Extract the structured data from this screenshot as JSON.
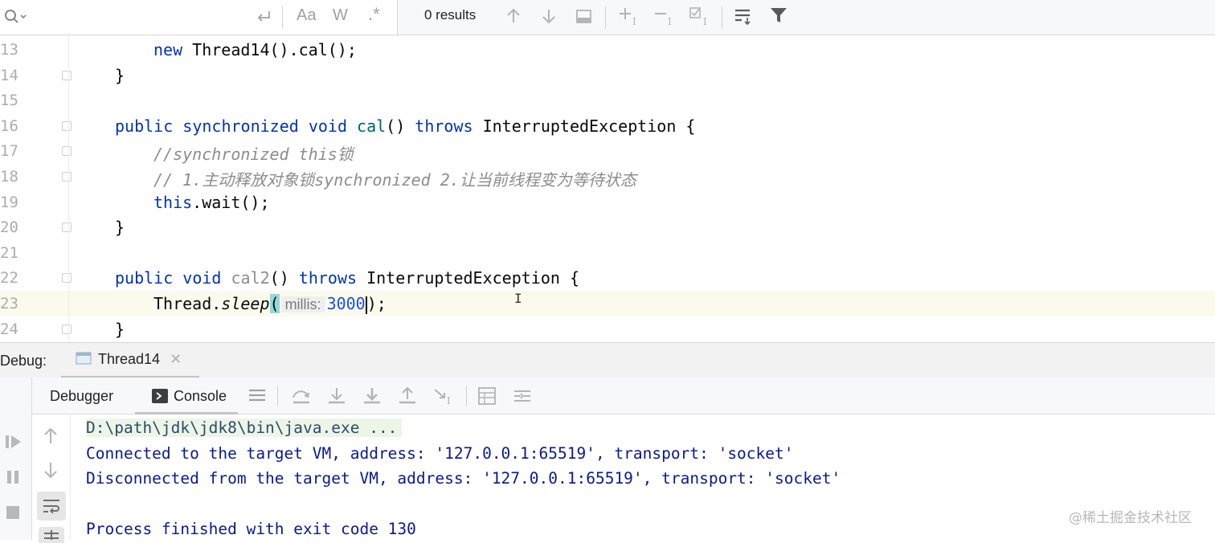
{
  "find_bar": {
    "search_value": "",
    "match_case_label": "Aa",
    "words_label": "W",
    "regex_label": ".*",
    "results": "0 results"
  },
  "editor": {
    "lines": [
      {
        "num": "13",
        "indent": 2,
        "tokens": [
          {
            "t": "new",
            "c": "kw"
          },
          {
            "t": " Thread14().cal();",
            "c": ""
          }
        ]
      },
      {
        "num": "14",
        "indent": 1,
        "tokens": [
          {
            "t": "}",
            "c": ""
          }
        ]
      },
      {
        "num": "15",
        "indent": 0,
        "tokens": []
      },
      {
        "num": "16",
        "indent": 1,
        "tokens": [
          {
            "t": "public synchronized void ",
            "c": "kw"
          },
          {
            "t": "cal",
            "c": "fn"
          },
          {
            "t": "() ",
            "c": ""
          },
          {
            "t": "throws",
            "c": "kw"
          },
          {
            "t": " InterruptedException {",
            "c": ""
          }
        ]
      },
      {
        "num": "17",
        "indent": 2,
        "tokens": [
          {
            "t": "//synchronized this锁",
            "c": "cm"
          }
        ]
      },
      {
        "num": "18",
        "indent": 2,
        "tokens": [
          {
            "t": "// 1.主动释放对象锁synchronized 2.让当前线程变为等待状态",
            "c": "cm"
          }
        ]
      },
      {
        "num": "19",
        "indent": 2,
        "tokens": [
          {
            "t": "this",
            "c": "kw"
          },
          {
            "t": ".wait();",
            "c": ""
          }
        ]
      },
      {
        "num": "20",
        "indent": 1,
        "tokens": [
          {
            "t": "}",
            "c": ""
          }
        ]
      },
      {
        "num": "21",
        "indent": 0,
        "tokens": []
      },
      {
        "num": "22",
        "indent": 1,
        "tokens": [
          {
            "t": "public void ",
            "c": "kw"
          },
          {
            "t": "cal2",
            "c": "cm2"
          },
          {
            "t": "() ",
            "c": ""
          },
          {
            "t": "throws",
            "c": "kw"
          },
          {
            "t": " InterruptedException {",
            "c": ""
          }
        ]
      },
      {
        "num": "23",
        "indent": 2,
        "tokens": []
      },
      {
        "num": "24",
        "indent": 1,
        "tokens": [
          {
            "t": "}",
            "c": ""
          }
        ]
      }
    ],
    "line23": {
      "before": "Thread.",
      "method": "sleep",
      "open": "(",
      "hint": "millis:",
      "arg": "3000",
      "close": ");"
    }
  },
  "debug": {
    "label": "Debug:",
    "tab_name": "Thread14",
    "tabs": [
      "Debugger",
      "Console"
    ]
  },
  "console": {
    "lines": [
      "D:\\path\\jdk\\jdk8\\bin\\java.exe ...",
      "Connected to the target VM, address: '127.0.0.1:65519', transport: 'socket'",
      "Disconnected from the target VM, address: '127.0.0.1:65519', transport: 'socket'",
      "",
      "Process finished with exit code 130"
    ]
  },
  "watermark": "@稀土掘金技术社区",
  "colors": {
    "keyword": "#0033b3",
    "function": "#00627a",
    "comment": "#8c8c8c",
    "number": "#1750eb",
    "console_text": "#0a1a8c",
    "current_line": "#fcfaed"
  }
}
